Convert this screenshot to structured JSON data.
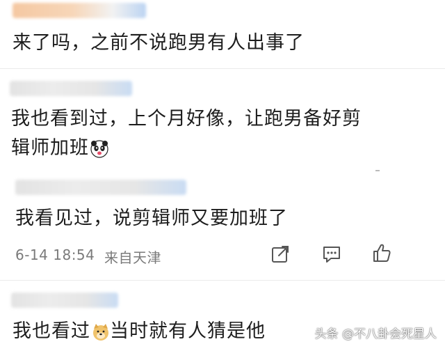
{
  "comments": [
    {
      "text": "来了吗，之前不说跑男有人出事了"
    },
    {
      "text_line1": "我也看到过，上个月好像，让跑男备好剪",
      "text_line2": "辑师加班",
      "emoji": "panda-emoji"
    }
  ],
  "reply": {
    "text": "我看见过，说剪辑师又要加班了",
    "time": "6-14 18:54",
    "location": "来自天津",
    "actions": [
      "share-icon",
      "comment-icon",
      "like-icon"
    ]
  },
  "last_comment": {
    "text_before": "我也看过",
    "emoji": "doge-emoji",
    "text_after": "当时就有人猜是他"
  },
  "watermark": "头条 @不八卦会死星人",
  "colors": {
    "text": "#1d1d1d",
    "meta": "#7a7a7a",
    "divider": "#ebebeb",
    "reply_bg": "#ffffff"
  }
}
